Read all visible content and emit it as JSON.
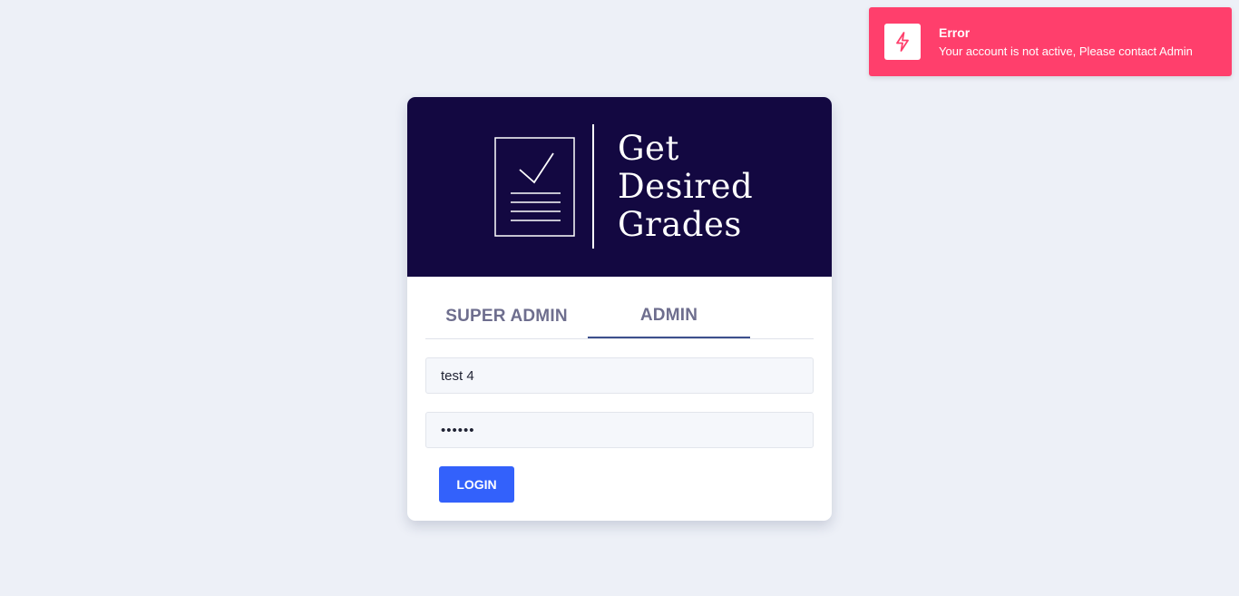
{
  "toast": {
    "title": "Error",
    "message": "Your account is not active, Please contact Admin",
    "icon": "lightning-icon",
    "color": "#ff3f6c"
  },
  "logo": {
    "line1": "Get",
    "line2": "Desired",
    "line3": "Grades",
    "icon": "document-check-icon",
    "background": "#130841"
  },
  "tabs": [
    {
      "label": "SUPER ADMIN",
      "active": false
    },
    {
      "label": "ADMIN",
      "active": true
    }
  ],
  "form": {
    "username_value": "test 4",
    "password_value": "••••••",
    "login_label": "LOGIN",
    "accent": "#3361fb"
  }
}
